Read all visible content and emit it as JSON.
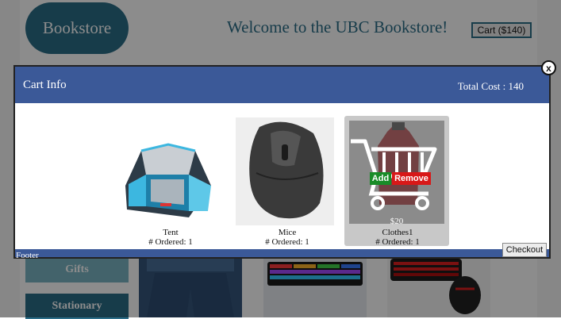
{
  "header": {
    "logo": "Bookstore",
    "welcome": "Welcome to the UBC Bookstore!",
    "cart_button": "Cart ($140)"
  },
  "sidebar": {
    "items": [
      {
        "label": "Gifts"
      },
      {
        "label": "Stationary"
      }
    ]
  },
  "modal": {
    "title": "Cart Info",
    "total": "Total Cost : 140",
    "close": "x",
    "footer": "Footer",
    "checkout": "Checkout",
    "items": [
      {
        "name": "Tent",
        "ordered": "# Ordered: 1"
      },
      {
        "name": "Mice",
        "ordered": "# Ordered: 1"
      },
      {
        "name": "Clothes1",
        "ordered": "# Ordered: 1",
        "price": "$20",
        "add": "Add",
        "remove": "Remove"
      }
    ]
  },
  "colors": {
    "brand": "#2b6d88",
    "modal_header": "#3b5998",
    "add": "#198c28",
    "remove": "#d81818"
  }
}
